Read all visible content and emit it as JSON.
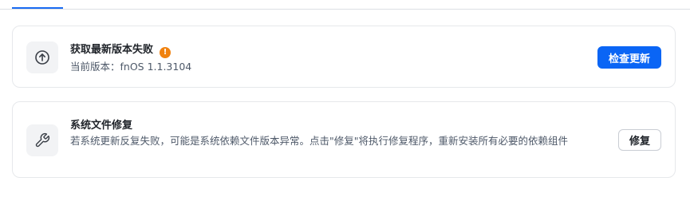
{
  "update_card": {
    "title": "获取最新版本失败",
    "warning_badge": "!",
    "version_text": "当前版本：fnOS 1.1.3104",
    "check_button": "检查更新",
    "icon": "arrow-up-circle-icon"
  },
  "repair_card": {
    "title": "系统文件修复",
    "description": "若系统更新反复失败，可能是系统依赖文件版本异常。点击\"修复\"将执行修复程序，重新安装所有必要的依赖组件",
    "repair_button": "修复",
    "icon": "wrench-icon"
  },
  "colors": {
    "primary": "#0a65f5",
    "warning": "#f0820f",
    "tab_indicator": "#1a6bf2"
  }
}
